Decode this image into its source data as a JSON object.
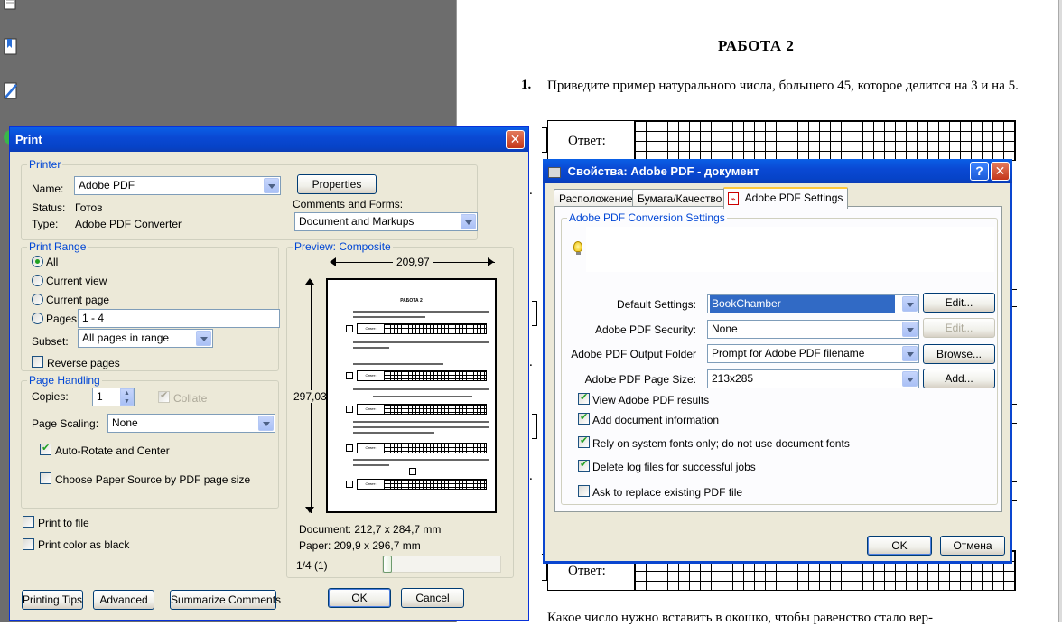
{
  "viewer": {
    "side_icons": [
      "pages-icon",
      "bookmarks-icon",
      "signatures-icon",
      "help-icon"
    ],
    "doc": {
      "title": "РАБОТА 2",
      "q1_number": "1.",
      "q1_text": "Приведите пример натурального числа, большего 45, которое делится на 3 и на 5.",
      "answer_label": "Ответ:",
      "q3_text": "Какое число нужно вставить в окошко, чтобы равенство стало вер-",
      "bullet": "."
    }
  },
  "print_dialog": {
    "title": "Print",
    "printer": {
      "group_title": "Printer",
      "name_label": "Name:",
      "name_value": "Adobe PDF",
      "status_label": "Status:",
      "status_value": "Готов",
      "type_label": "Type:",
      "type_value": "Adobe PDF Converter",
      "properties_button": "Properties",
      "comments_label": "Comments and Forms:",
      "comments_value": "Document and Markups"
    },
    "range": {
      "group_title": "Print Range",
      "all": "All",
      "current_view": "Current view",
      "current_page": "Current page",
      "pages": "Pages",
      "pages_value": "1 - 4",
      "subset_label": "Subset:",
      "subset_value": "All pages in range",
      "reverse": "Reverse pages"
    },
    "handling": {
      "group_title": "Page Handling",
      "copies_label": "Copies:",
      "copies_value": "1",
      "collate": "Collate",
      "scaling_label": "Page Scaling:",
      "scaling_value": "None",
      "auto_rotate": "Auto-Rotate and Center",
      "paper_source": "Choose Paper Source by PDF page size"
    },
    "print_to_file": "Print to file",
    "print_color_black": "Print color as black",
    "preview": {
      "group_title": "Preview: Composite",
      "width_label": "209,97",
      "height_label": "297,03",
      "document_size": "Document: 212,7 x 284,7 mm",
      "paper_size": "Paper: 209,9 x 296,7 mm",
      "page_counter": "1/4 (1)",
      "thumb_title": "РАБОТА 2",
      "thumb_answer": "Ответ:"
    },
    "buttons": {
      "printing_tips": "Printing Tips",
      "advanced": "Advanced",
      "summarize": "Summarize Comments",
      "ok": "OK",
      "cancel": "Cancel"
    }
  },
  "props_dialog": {
    "title": "Свойства: Adobe PDF - документ",
    "help": "?",
    "close": "✕",
    "tabs": [
      "Расположение",
      "Бумага/Качество",
      "Adobe PDF Settings"
    ],
    "group_title": "Adobe PDF Conversion Settings",
    "rows": [
      {
        "label": "Default Settings:",
        "value": "BookChamber",
        "button": "Edit..."
      },
      {
        "label": "Adobe PDF Security:",
        "value": "None",
        "button": "Edit..."
      },
      {
        "label": "Adobe PDF Output Folder",
        "value": "Prompt for Adobe PDF filename",
        "button": "Browse..."
      },
      {
        "label": "Adobe PDF Page Size:",
        "value": "213x285",
        "button": "Add..."
      }
    ],
    "checks": [
      {
        "label": "View Adobe PDF results",
        "checked": true
      },
      {
        "label": "Add document information",
        "checked": true
      },
      {
        "label": "Rely on system fonts only; do not use document fonts",
        "checked": true
      },
      {
        "label": "Delete log files for successful jobs",
        "checked": true
      },
      {
        "label": "Ask to replace existing PDF file",
        "checked": false
      }
    ],
    "ok": "OK",
    "cancel": "Отмена"
  }
}
